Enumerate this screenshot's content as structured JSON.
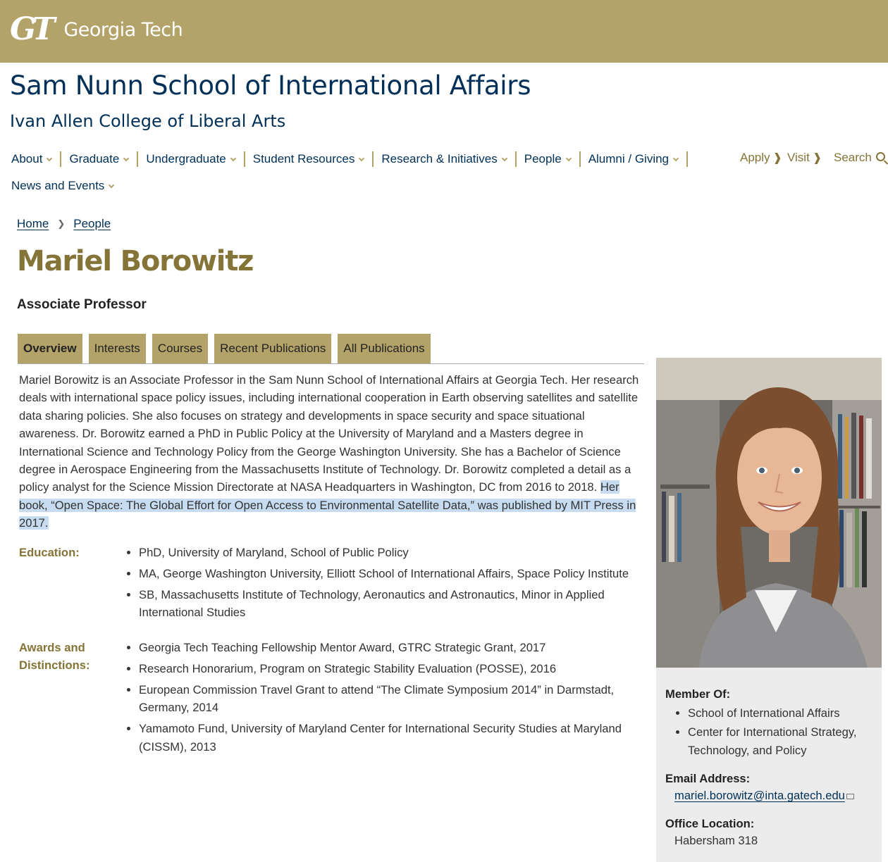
{
  "header": {
    "logo_mark": "GT",
    "logo_word": "Georgia Tech",
    "school": "Sam Nunn School of International Affairs",
    "college": "Ivan Allen College of Liberal Arts"
  },
  "nav": {
    "items": [
      "About",
      "Graduate",
      "Undergraduate",
      "Student Resources",
      "Research & Initiatives",
      "People",
      "Alumni / Giving"
    ],
    "second_row": "News and Events",
    "apply": "Apply",
    "visit": "Visit",
    "search": "Search",
    "arrow": "❱"
  },
  "breadcrumb": {
    "home": "Home",
    "sep": "❯",
    "people": "People"
  },
  "profile": {
    "name": "Mariel Borowitz",
    "title": "Associate Professor"
  },
  "tabs": [
    "Overview",
    "Interests",
    "Courses",
    "Recent Publications",
    "All Publications"
  ],
  "bio": {
    "text": "Mariel Borowitz is an Associate Professor in the Sam Nunn School of International Affairs at Georgia Tech. Her research deals with international space policy issues, including international cooperation in Earth observing satellites and satellite data sharing policies. She also focuses on strategy and developments in space security and space situational awareness. Dr. Borowitz earned a PhD in Public Policy at the University of Maryland and a Masters degree in International Science and Technology Policy from the George Washington University. She has a Bachelor of Science degree in Aerospace Engineering from the Massachusetts Institute of Technology. Dr. Borowitz completed a detail as a policy analyst for the Science Mission Directorate at NASA Headquarters in Washington, DC from 2016 to 2018. ",
    "highlighted": "Her book, “Open Space: The Global Effort for Open Access to Environmental Satellite Data,” was published by MIT Press in 2017."
  },
  "education": {
    "label": "Education:",
    "items": [
      "PhD, University of Maryland, School of Public Policy",
      "MA, George Washington University, Elliott School of International Affairs, Space Policy Institute",
      "SB, Massachusetts Institute of Technology, Aeronautics and Astronautics, Minor in Applied International Studies"
    ]
  },
  "awards": {
    "label": "Awards and Distinctions:",
    "items": [
      "Georgia Tech Teaching Fellowship Mentor Award, GTRC Strategic Grant, 2017",
      "Research Honorarium, Program on Strategic Stability Evaluation (POSSE), 2016",
      "European Commission Travel Grant to attend “The Climate Symposium 2014” in Darmstadt, Germany, 2014",
      "Yamamoto Fund, University of Maryland Center for International Security Studies at Maryland (CISSM), 2013"
    ]
  },
  "sidebar": {
    "member_label": "Member Of:",
    "members": [
      "School of International Affairs",
      "Center for International Strategy, Technology, and Policy"
    ],
    "email_label": "Email Address:",
    "email": "mariel.borowitz@inta.gatech.edu",
    "office_label": "Office Location:",
    "office": "Habersham 318"
  },
  "colors": {
    "gold": "#b3a369",
    "dark_gold": "#857437",
    "navy": "#003057",
    "highlight": "#c7dcf1"
  }
}
